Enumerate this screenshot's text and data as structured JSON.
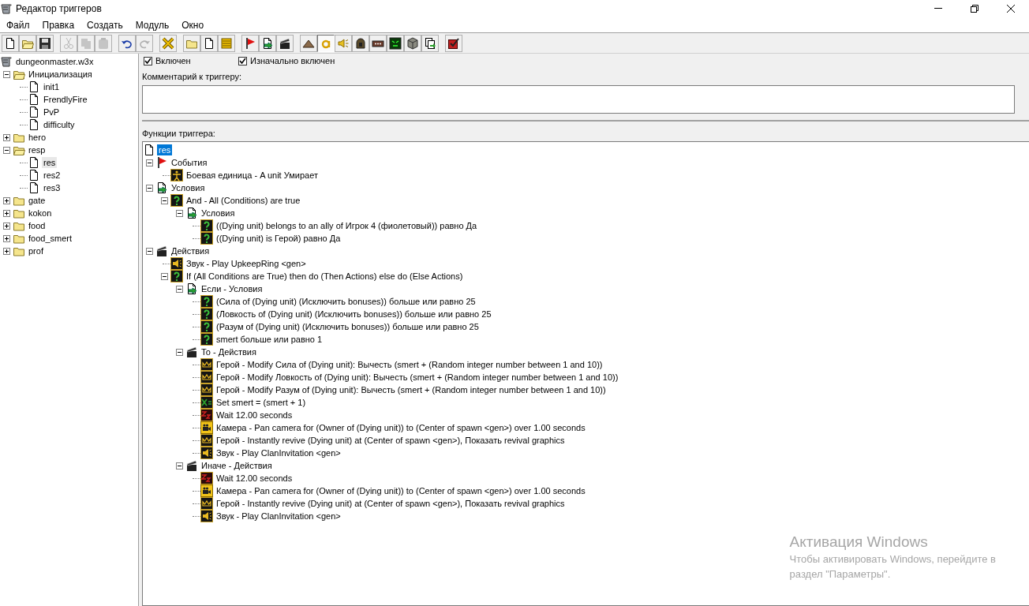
{
  "window": {
    "title": "Редактор триггеров",
    "controls": [
      {
        "kind": "minimize"
      },
      {
        "kind": "restore"
      },
      {
        "kind": "close"
      }
    ]
  },
  "menu": [
    "Файл",
    "Правка",
    "Создать",
    "Модуль",
    "Окно"
  ],
  "toolbar": [
    [
      {
        "kind": "new",
        "disabled": false,
        "pressed": false
      },
      {
        "kind": "open",
        "disabled": false,
        "pressed": false
      },
      {
        "kind": "save",
        "disabled": false,
        "pressed": false
      }
    ],
    [
      {
        "kind": "cut",
        "disabled": true,
        "pressed": false
      },
      {
        "kind": "copy",
        "disabled": true,
        "pressed": false
      },
      {
        "kind": "paste",
        "disabled": true,
        "pressed": false
      }
    ],
    [
      {
        "kind": "undo",
        "disabled": false,
        "pressed": false
      },
      {
        "kind": "redo",
        "disabled": true,
        "pressed": false
      }
    ],
    [
      {
        "kind": "delete",
        "disabled": false,
        "pressed": false
      }
    ],
    [
      {
        "kind": "folder",
        "disabled": false,
        "pressed": false
      },
      {
        "kind": "file",
        "disabled": false,
        "pressed": false
      },
      {
        "kind": "comment",
        "disabled": false,
        "pressed": false
      }
    ],
    [
      {
        "kind": "event",
        "disabled": false,
        "pressed": false
      },
      {
        "kind": "condition",
        "disabled": false,
        "pressed": false
      },
      {
        "kind": "action",
        "disabled": false,
        "pressed": false
      }
    ],
    [
      {
        "kind": "terrain",
        "disabled": false,
        "pressed": false
      },
      {
        "kind": "text",
        "disabled": false,
        "pressed": true
      },
      {
        "kind": "sound",
        "disabled": false,
        "pressed": false
      },
      {
        "kind": "unit",
        "disabled": false,
        "pressed": false
      },
      {
        "kind": "item",
        "disabled": false,
        "pressed": false
      },
      {
        "kind": "ai",
        "disabled": false,
        "pressed": false
      },
      {
        "kind": "doodad",
        "disabled": false,
        "pressed": false
      },
      {
        "kind": "import",
        "disabled": false,
        "pressed": false
      }
    ],
    [
      {
        "kind": "test",
        "disabled": false,
        "pressed": false
      }
    ]
  ],
  "sidebar": {
    "tree": [
      {
        "label": "dungeonmaster.w3x",
        "kind": "map",
        "selected": false,
        "children": [
          {
            "label": "Инициализация",
            "kind": "folder",
            "expanded": true,
            "selected": false,
            "children": [
              {
                "label": "init1",
                "kind": "file",
                "selected": false
              },
              {
                "label": "FrendlyFire",
                "kind": "file",
                "selected": false
              },
              {
                "label": "PvP",
                "kind": "file",
                "selected": false
              },
              {
                "label": "difficulty",
                "kind": "file",
                "selected": false
              }
            ]
          },
          {
            "label": "hero",
            "kind": "folder",
            "expanded": false,
            "selected": false
          },
          {
            "label": "resp",
            "kind": "folder",
            "expanded": true,
            "selected": false,
            "children": [
              {
                "label": "res",
                "kind": "file",
                "selected": true
              },
              {
                "label": "res2",
                "kind": "file",
                "selected": false
              },
              {
                "label": "res3",
                "kind": "file",
                "selected": false
              }
            ]
          },
          {
            "label": "gate",
            "kind": "folder",
            "expanded": false,
            "selected": false
          },
          {
            "label": "kokon",
            "kind": "folder",
            "expanded": false,
            "selected": false
          },
          {
            "label": "food",
            "kind": "folder",
            "expanded": false,
            "selected": false
          },
          {
            "label": "food_smert",
            "kind": "folder",
            "expanded": false,
            "selected": false
          },
          {
            "label": "prof",
            "kind": "folder",
            "expanded": false,
            "selected": false
          }
        ]
      }
    ]
  },
  "trigger": {
    "checkboxes": [
      {
        "label": "Включен",
        "checked": true
      },
      {
        "label": "Изначально включен",
        "checked": true
      }
    ],
    "comment_label": "Комментарий к триггеру:",
    "functions_label": "Функции триггера:",
    "tree": [
      {
        "label": "res",
        "kind": "file",
        "selected": true,
        "children": [
          {
            "label": "События",
            "kind": "event",
            "expanded": true,
            "selected": false,
            "children": [
              {
                "label": "Боевая единица - A unit Умирает",
                "kind": "unit",
                "selected": false
              }
            ]
          },
          {
            "label": "Условия",
            "kind": "conditions",
            "expanded": true,
            "selected": false,
            "children": [
              {
                "label": "And - All (Conditions) are true",
                "kind": "condition",
                "expanded": true,
                "selected": false,
                "children": [
                  {
                    "label": "Условия",
                    "kind": "conditions",
                    "expanded": true,
                    "selected": false,
                    "children": [
                      {
                        "label": "((Dying unit) belongs to an ally of Игрок 4 (фиолетовый)) равно Да",
                        "kind": "condition",
                        "selected": false
                      },
                      {
                        "label": "((Dying unit) is Герой) равно Да",
                        "kind": "condition",
                        "selected": false
                      }
                    ]
                  }
                ]
              }
            ]
          },
          {
            "label": "Действия",
            "kind": "actions",
            "expanded": true,
            "selected": false,
            "children": [
              {
                "label": "Звук - Play UpkeepRing <gen>",
                "kind": "sound",
                "selected": false
              },
              {
                "label": "If (All Conditions are True) then do (Then Actions) else do (Else Actions)",
                "kind": "condition",
                "expanded": true,
                "selected": false,
                "children": [
                  {
                    "label": "Если - Условия",
                    "kind": "conditions",
                    "expanded": true,
                    "selected": false,
                    "children": [
                      {
                        "label": "(Сила of (Dying unit) (Исключить bonuses)) больше или равно 25",
                        "kind": "condition",
                        "selected": false
                      },
                      {
                        "label": "(Ловкость of (Dying unit) (Исключить bonuses)) больше или равно 25",
                        "kind": "condition",
                        "selected": false
                      },
                      {
                        "label": "(Разум of (Dying unit) (Исключить bonuses)) больше или равно 25",
                        "kind": "condition",
                        "selected": false
                      },
                      {
                        "label": "smert больше или равно 1",
                        "kind": "condition",
                        "selected": false
                      }
                    ]
                  },
                  {
                    "label": "То - Действия",
                    "kind": "actions",
                    "expanded": true,
                    "selected": false,
                    "children": [
                      {
                        "label": "Герой - Modify Сила of (Dying unit): Вычесть (smert + (Random integer number between 1 and 10))",
                        "kind": "hero",
                        "selected": false
                      },
                      {
                        "label": "Герой - Modify Ловкость of (Dying unit): Вычесть (smert + (Random integer number between 1 and 10))",
                        "kind": "hero",
                        "selected": false
                      },
                      {
                        "label": "Герой - Modify Разум of (Dying unit): Вычесть (smert + (Random integer number between 1 and 10))",
                        "kind": "hero",
                        "selected": false
                      },
                      {
                        "label": "Set smert = (smert + 1)",
                        "kind": "set",
                        "selected": false
                      },
                      {
                        "label": "Wait 12.00 seconds",
                        "kind": "wait",
                        "selected": false
                      },
                      {
                        "label": "Камера - Pan camera for (Owner of (Dying unit)) to (Center of spawn <gen>) over 1.00 seconds",
                        "kind": "camera",
                        "selected": false
                      },
                      {
                        "label": "Герой - Instantly revive (Dying unit) at (Center of spawn <gen>), Показать revival graphics",
                        "kind": "hero",
                        "selected": false
                      },
                      {
                        "label": "Звук - Play ClanInvitation <gen>",
                        "kind": "sound",
                        "selected": false
                      }
                    ]
                  },
                  {
                    "label": "Иначе - Действия",
                    "kind": "actions",
                    "expanded": true,
                    "selected": false,
                    "children": [
                      {
                        "label": "Wait 12.00 seconds",
                        "kind": "wait",
                        "selected": false
                      },
                      {
                        "label": "Камера - Pan camera for (Owner of (Dying unit)) to (Center of spawn <gen>) over 1.00 seconds",
                        "kind": "camera",
                        "selected": false
                      },
                      {
                        "label": "Герой - Instantly revive (Dying unit) at (Center of spawn <gen>), Показать revival graphics",
                        "kind": "hero",
                        "selected": false
                      },
                      {
                        "label": "Звук - Play ClanInvitation <gen>",
                        "kind": "sound",
                        "selected": false
                      }
                    ]
                  }
                ]
              }
            ]
          }
        ]
      }
    ]
  },
  "os_overlay": {
    "title": "Активация Windows",
    "lines": [
      "Чтобы активировать Windows, перейдите в",
      "раздел \"Параметры\"."
    ]
  }
}
